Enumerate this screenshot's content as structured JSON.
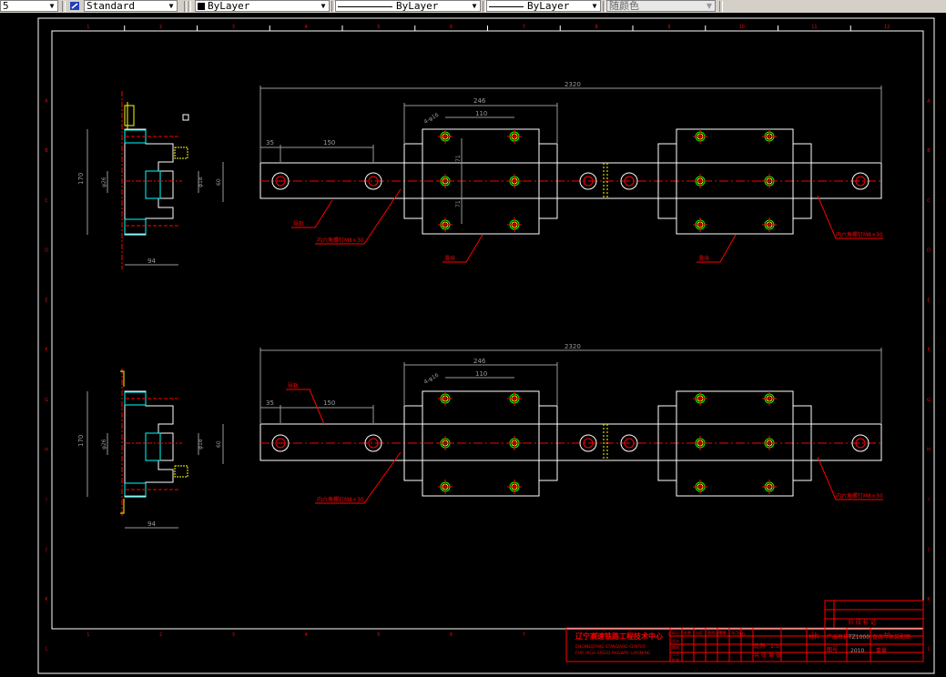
{
  "toolbar": {
    "dim_style_partial": "5",
    "text_style": "Standard",
    "layer_color": "ByLayer",
    "linetype": "ByLayer",
    "lineweight": "ByLayer",
    "plot_style": "随颜色"
  },
  "drawing": {
    "border_numbers_top": [
      "1",
      "2",
      "3",
      "4",
      "5",
      "6",
      "7",
      "8",
      "9",
      "10",
      "11",
      "12"
    ],
    "border_numbers_bottom": [
      "1",
      "2",
      "3",
      "4",
      "5",
      "6",
      "7",
      "8",
      "9",
      "10",
      "11",
      "12"
    ],
    "border_letters_left": [
      "A",
      "B",
      "C",
      "D",
      "E",
      "F",
      "G",
      "H",
      "I",
      "J",
      "K",
      "L"
    ],
    "border_letters_right": [
      "A",
      "B",
      "C",
      "D",
      "E",
      "F",
      "G",
      "H",
      "I",
      "J",
      "K",
      "L"
    ],
    "view1": {
      "overall_dim": "2320",
      "carriage_dim": "246",
      "hole_pitch_dim": "110",
      "dim_35": "35",
      "dim_150": "150",
      "dim_71a": "71",
      "dim_71b": "71",
      "hole_note": "4-φ16",
      "label_rail": "导轨",
      "label_bolt_left": "内六角螺钉M8×30",
      "label_carriage_a": "滑块",
      "label_carriage_b": "滑块",
      "label_bolt_right": "内六角螺钉M8×30"
    },
    "view2": {
      "overall_dim": "2320",
      "carriage_dim": "246",
      "hole_pitch_dim": "110",
      "dim_35": "35",
      "dim_150": "150",
      "hole_note": "4-φ16",
      "label_rail": "导轨",
      "label_bolt_left": "内六角螺钉M8×30",
      "label_bolt_right": "内六角螺钉M8×30"
    },
    "side_view1": {
      "height_dim": "170",
      "width_dim": "94",
      "d1": "φ26",
      "d2": "φ18",
      "d3": "60"
    },
    "side_view2": {
      "height_dim": "170",
      "width_dim": "94",
      "d1": "φ26",
      "d2": "φ18",
      "d3": "60"
    },
    "title_block": {
      "company_cn": "辽宁高速铁路工程技术中心",
      "company_en1": "ENGINEERING STANDARD CENTER",
      "company_en2": "FOR HIGH SPEED RAILWAY LIAONING",
      "headers": [
        "标记",
        "处数",
        "分区",
        "更改文件号",
        "签名",
        "年月日"
      ],
      "row_labels": [
        "设计",
        "审核",
        "工艺",
        "批准"
      ],
      "scale_label": "比例",
      "scale_value": "1:5",
      "sheet_label": "共 张 第 张",
      "product_label": "产品名称",
      "product_value": "直线导轨装配图",
      "code_label": "图号",
      "code_value": "TZ1000",
      "year": "2010",
      "material": "材料",
      "weight": "重量",
      "rev_label": "阶 段 标 记"
    }
  },
  "colors": {
    "background": "#000000",
    "line_white": "#ffffff",
    "line_red": "#ff0000",
    "line_yellow": "#ffff00",
    "line_cyan": "#00ffff",
    "line_green": "#00ff00",
    "dim_gray": "#9a9a9a",
    "toolbar_bg": "#d4d0c8"
  }
}
